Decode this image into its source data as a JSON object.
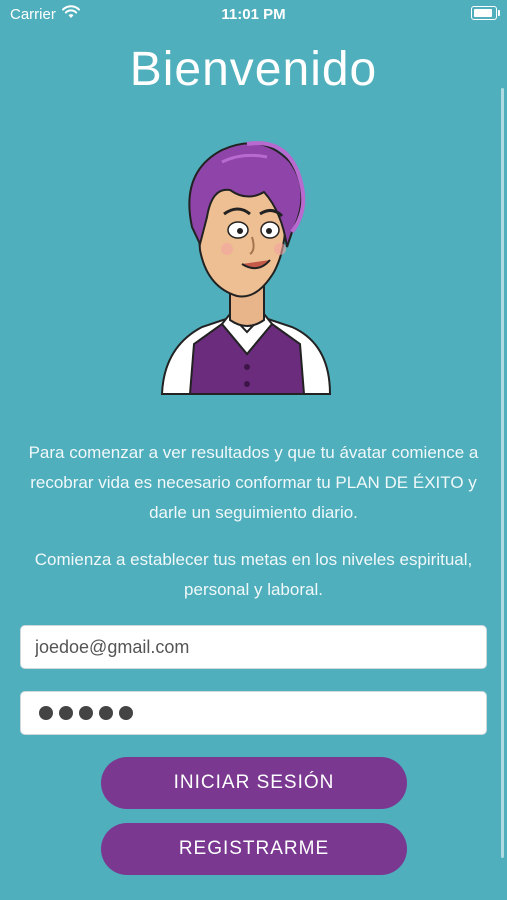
{
  "status_bar": {
    "carrier": "Carrier",
    "time": "11:01 PM"
  },
  "title": "Bienvenido",
  "intro_text": "Para comenzar a ver resultados y que tu ávatar comience a recobrar vida es necesario conformar tu PLAN DE ÉXITO y darle un seguimiento diario.",
  "sub_text": "Comienza a establecer tus metas en los niveles espiritual, personal y laboral.",
  "email_field": {
    "value": "joedoe@gmail.com"
  },
  "password_field": {
    "masked_length": 5
  },
  "buttons": {
    "login": "INICIAR SESIÓN",
    "register": "REGISTRARME"
  },
  "colors": {
    "background": "#4fafbc",
    "button": "#7a3891",
    "hair": "#8e44a8"
  }
}
